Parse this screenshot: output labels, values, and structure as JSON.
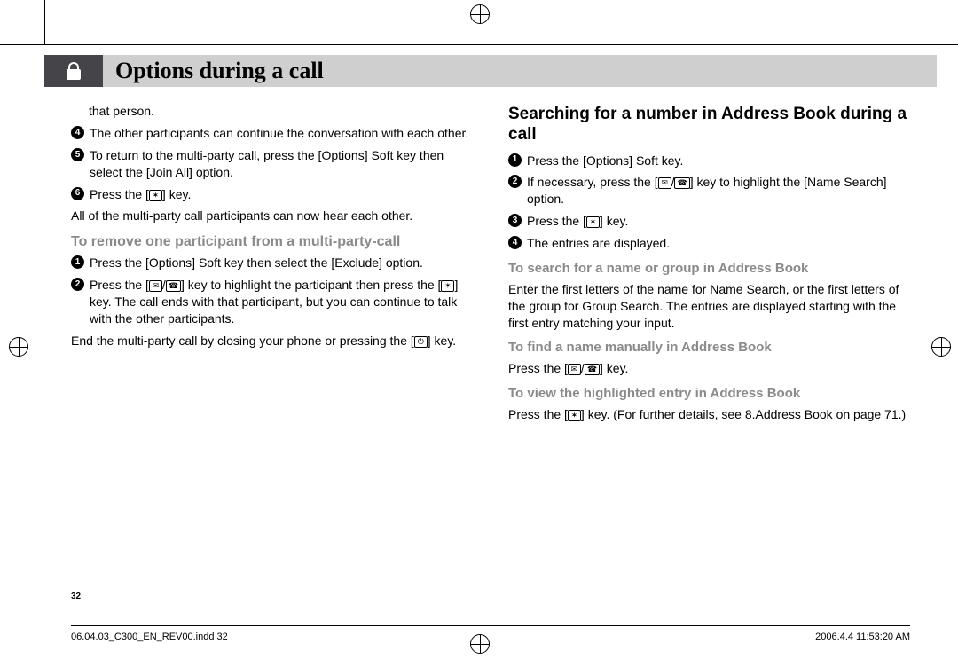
{
  "title": "Options during a call",
  "page_number": "32",
  "left_column": {
    "intro_fragment": "that person.",
    "items": [
      {
        "n": "4",
        "text": "The other participants can continue the conversation with each other."
      },
      {
        "n": "5",
        "text": "To return to the multi-party call, press the [Options] Soft key then select the [Join All] option."
      },
      {
        "n": "6",
        "text": "Press the [KEY_OK] key."
      }
    ],
    "after_items": "All of the multi-party call participants can now hear each other.",
    "sub_heading": "To remove one participant from a multi-party-call",
    "sub_items": [
      {
        "n": "1",
        "text": "Press the [Options] Soft key then select the [Exclude] option."
      },
      {
        "n": "2",
        "text": "Press the [KEY_MSG/KEY_CALL] key to highlight the participant then press the [KEY_OK] key. The call ends with that participant, but you can continue to talk with the other participants."
      }
    ],
    "sub_outro": "End the multi-party call by closing your phone or pressing the [KEY_END] key."
  },
  "right_column": {
    "heading": "Searching for a number in Address Book during a call",
    "items": [
      {
        "n": "1",
        "text": "Press the [Options] Soft key."
      },
      {
        "n": "2",
        "text": "If necessary, press the [KEY_MSG/KEY_CALL] key to highlight the [Name Search] option."
      },
      {
        "n": "3",
        "text": "Press the [KEY_OK] key."
      },
      {
        "n": "4",
        "text": "The entries are displayed."
      }
    ],
    "sub1_heading": "To search for a name or group in Address Book",
    "sub1_body": "Enter the first letters of the name for Name Search, or the first letters of the group for Group Search. The entries are displayed starting with the first entry matching your input.",
    "sub2_heading": "To find a name manually in Address Book",
    "sub2_body": "Press the [KEY_MSG/KEY_CALL] key.",
    "sub3_heading": "To view the highlighted entry in Address Book",
    "sub3_body": "Press the [KEY_OK] key. (For further details, see 8.Address Book on page 71.)"
  },
  "footer": {
    "left": "06.04.03_C300_EN_REV00.indd   32",
    "right": "2006.4.4   11:53:20 AM"
  },
  "keys": {
    "ok": "✶",
    "msg": "✉",
    "call": "☎",
    "end": "⏻"
  }
}
